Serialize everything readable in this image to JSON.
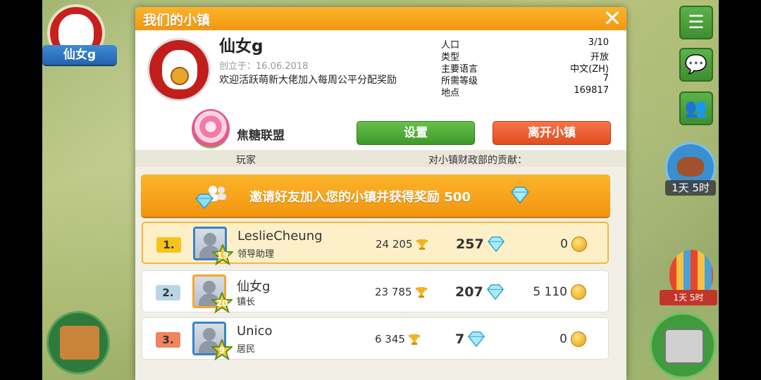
{
  "hud": {
    "player_name": "仙女g",
    "timer_label": "1天 5时",
    "balloon_label": "1天 5时"
  },
  "panel": {
    "title": "我们的小镇",
    "close_icon": "✕"
  },
  "town": {
    "name": "仙女g",
    "founded": "创立于：16.06.2018",
    "description": "欢迎活跃萌新大佬加入每周公平分配奖励",
    "stats": [
      {
        "label": "人口",
        "value": "3/10"
      },
      {
        "label": "类型",
        "value": "开放"
      },
      {
        "label": "主要语言",
        "value": "中文(ZH)"
      },
      {
        "label": "所需等级",
        "value": "7"
      },
      {
        "label": "地点",
        "value": "169817"
      }
    ],
    "alliance": "焦糖联盟",
    "settings_label": "设置",
    "leave_label": "离开小镇"
  },
  "columns": {
    "player": "玩家",
    "contribution": "对小镇财政部的贡献："
  },
  "invite": {
    "text": "邀请好友加入您的小镇并获得奖励 500"
  },
  "members": [
    {
      "rank": "1.",
      "name": "LeslieCheung",
      "role": "领导助理",
      "level": "19",
      "trophies": "24 205",
      "gems": "257",
      "coins": "0"
    },
    {
      "rank": "2.",
      "name": "仙女g",
      "role": "镇长",
      "level": "20",
      "trophies": "23 785",
      "gems": "207",
      "coins": "5 110"
    },
    {
      "rank": "3.",
      "name": "Unico",
      "role": "居民",
      "level": "9",
      "trophies": "6 345",
      "gems": "7",
      "coins": "0"
    }
  ],
  "colors": {
    "header_orange": "#f39811",
    "settings_green": "#3e9a2c",
    "leave_red": "#e24d1f",
    "highlight_row": "#fdf0c9"
  },
  "icons": [
    "lucky-cat-icon",
    "menu-list-icon",
    "chat-icon",
    "friends-diamond-icon",
    "bread-icon",
    "hot-air-balloon-icon",
    "house-icon",
    "cash-register-icon",
    "lollipop-icon",
    "trophy-icon",
    "diamond-icon",
    "coin-icon",
    "star-icon"
  ]
}
